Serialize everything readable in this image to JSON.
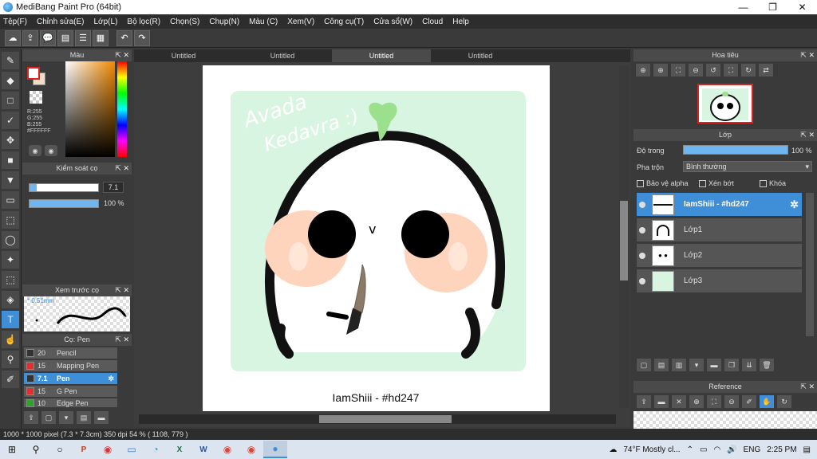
{
  "window": {
    "title": "MediBang Paint Pro (64bit)",
    "controls": [
      "—",
      "❐",
      "✕"
    ]
  },
  "menu": [
    "Tệp(F)",
    "Chỉnh sửa(E)",
    "Lớp(L)",
    "Bộ lọc(R)",
    "Chọn(S)",
    "Chụp(N)",
    "Màu (C)",
    "Xem(V)",
    "Công cụ(T)",
    "Cửa sổ(W)",
    "Cloud",
    "Help"
  ],
  "canvas_tabs": [
    "Untitled",
    "Untitled",
    "Untitled",
    "Untitled"
  ],
  "active_tab_index": 2,
  "color_panel": {
    "title": "Màu",
    "r": "R:255",
    "g": "G:255",
    "b": "B:255",
    "hex": "#FFFFFF",
    "fg_color": "#ffffff",
    "bg_color": "#f3dcc6"
  },
  "brush_control": {
    "title": "Kiểm soát cọ",
    "size_value": "7.1",
    "opacity_value": "100 %",
    "size_fraction": 0.1,
    "opacity_fraction": 1.0
  },
  "brush_preview": {
    "title": "Xem trước cọ",
    "size_label": "* 0.51mm"
  },
  "pen_panel": {
    "title": "Cọ: Pen",
    "items": [
      {
        "size": "20",
        "name": "Pencil",
        "color": "#333333"
      },
      {
        "size": "15",
        "name": "Mapping Pen",
        "color": "#e03030"
      },
      {
        "size": "7.1",
        "name": "Pen",
        "color": "#333333"
      },
      {
        "size": "15",
        "name": "G Pen",
        "color": "#e03030"
      },
      {
        "size": "10",
        "name": "Edge Pen",
        "color": "#30a030"
      }
    ],
    "selected_index": 2
  },
  "artwork": {
    "handwriting_line1": "Avada",
    "handwriting_line2": "Kedavra :)",
    "face_mark": "v",
    "signature": "IamShiii - #hd247"
  },
  "navigator": {
    "title": "Hoa tiêu"
  },
  "layers_panel": {
    "title": "Lớp",
    "opacity_label": "Độ trong",
    "opacity_value": "100 %",
    "blend_label": "Pha trộn",
    "blend_value": "Bình thường",
    "protect_alpha": "Bảo vệ alpha",
    "clipping": "Xén bớt",
    "lock": "Khóa",
    "layers": [
      {
        "name": "IamShiii - #hd247",
        "selected": true
      },
      {
        "name": "Lớp1",
        "selected": false
      },
      {
        "name": "Lớp2",
        "selected": false
      },
      {
        "name": "Lớp3",
        "selected": false
      }
    ]
  },
  "reference": {
    "title": "Reference"
  },
  "status": {
    "text": "1000 * 1000 pixel  (7.3 * 7.3cm)  350 dpi  54 %  ( 1108, 779 )"
  },
  "taskbar": {
    "weather": "74°F  Mostly cl...",
    "lang": "ENG",
    "time": "2:25 PM"
  }
}
